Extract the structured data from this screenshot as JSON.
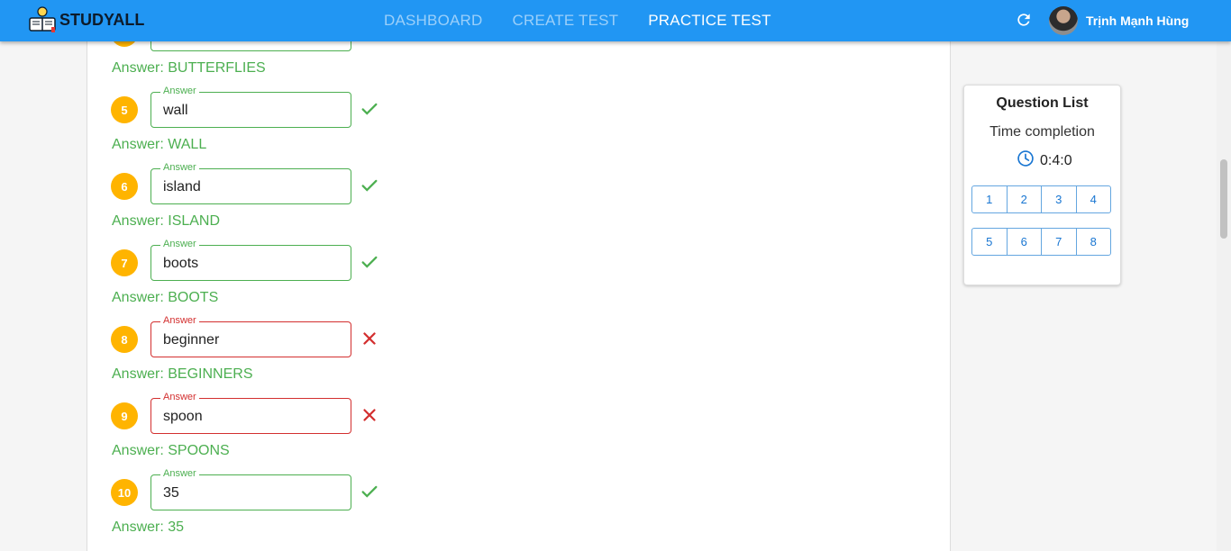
{
  "nav": {
    "brand": "STUDYALL",
    "links": [
      "DASHBOARD",
      "CREATE TEST",
      "PRACTICE TEST"
    ],
    "active_index": 2,
    "user_name": "Trịnh Mạnh Hùng"
  },
  "questions": [
    {
      "number": "",
      "value": "",
      "correct": true,
      "answer": "Answer: BUTTERFLIES",
      "field_label": "Answer"
    },
    {
      "number": "5",
      "value": "wall",
      "correct": true,
      "answer": "Answer: WALL",
      "field_label": "Answer"
    },
    {
      "number": "6",
      "value": "island",
      "correct": true,
      "answer": "Answer: ISLAND",
      "field_label": "Answer"
    },
    {
      "number": "7",
      "value": "boots",
      "correct": true,
      "answer": "Answer: BOOTS",
      "field_label": "Answer"
    },
    {
      "number": "8",
      "value": "beginner",
      "correct": false,
      "answer": "Answer: BEGINNERS",
      "field_label": "Answer"
    },
    {
      "number": "9",
      "value": "spoon",
      "correct": false,
      "answer": "Answer: SPOONS",
      "field_label": "Answer"
    },
    {
      "number": "10",
      "value": "35",
      "correct": true,
      "answer": "Answer: 35",
      "field_label": "Answer"
    }
  ],
  "question_list": {
    "title": "Question List",
    "time_label": "Time completion",
    "time_value": "0:4:0",
    "row1": [
      "1",
      "2",
      "3",
      "4"
    ],
    "row2": [
      "5",
      "6",
      "7",
      "8"
    ]
  },
  "colors": {
    "primary": "#2196f3",
    "correct": "#4caf50",
    "wrong": "#d32f2f",
    "badge": "#ffb400"
  }
}
